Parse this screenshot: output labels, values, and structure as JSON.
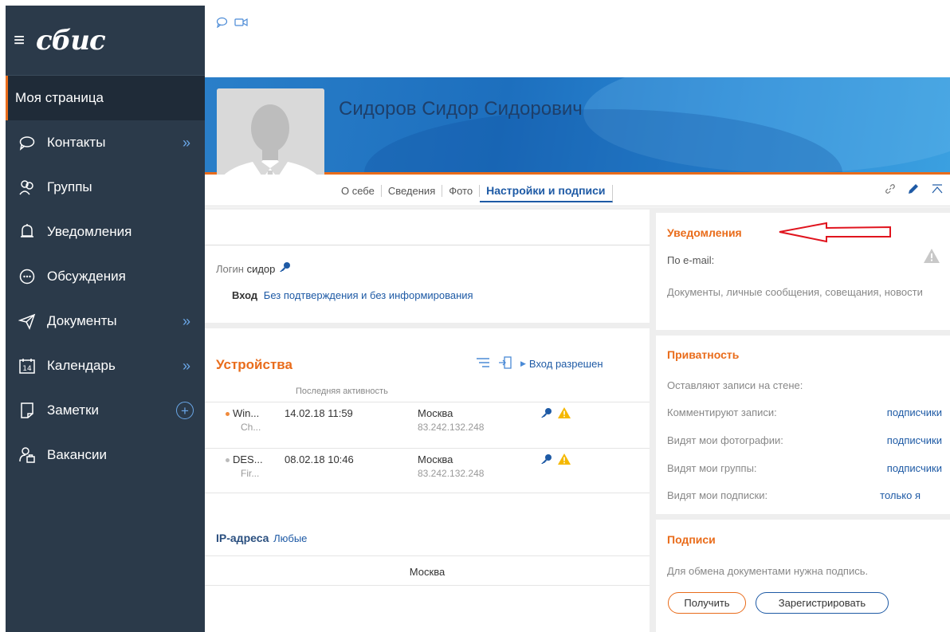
{
  "sidebar": {
    "logo": "сбис",
    "items": [
      {
        "label": "Моя страница"
      },
      {
        "label": "Контакты"
      },
      {
        "label": "Группы"
      },
      {
        "label": "Уведомления"
      },
      {
        "label": "Обсуждения"
      },
      {
        "label": "Документы"
      },
      {
        "label": "Календарь",
        "icon_text": "14"
      },
      {
        "label": "Заметки"
      },
      {
        "label": "Вакансии"
      }
    ]
  },
  "profile": {
    "name": "Сидоров Сидор Сидорович",
    "tabs": [
      "О себе",
      "Сведения",
      "Фото",
      "Настройки и подписи"
    ]
  },
  "login": {
    "label": "Логин",
    "value": "сидор",
    "entry_label": "Вход",
    "entry_value": "Без подтверждения и без информирования"
  },
  "devices": {
    "title": "Устройства",
    "subtitle": "Последняя активность",
    "allowed": "Вход разрешен",
    "rows": [
      {
        "os": "Win...",
        "browser": "Ch...",
        "datetime": "14.02.18  11:59",
        "city": "Москва",
        "ip": "83.242.132.248",
        "dot_color": "#f08a3c"
      },
      {
        "os": "DES...",
        "browser": "Fir...",
        "datetime": "08.02.18  10:46",
        "city": "Москва",
        "ip": "83.242.132.248",
        "dot_color": "#bbbbbb"
      }
    ],
    "ip_label": "IP-адреса",
    "ip_value": "Любые",
    "ip_city": "Москва"
  },
  "notifications": {
    "title": "Уведомления",
    "email_label": "По e-mail:",
    "description": "Документы, личные сообщения, совещания, новости"
  },
  "privacy": {
    "title": "Приватность",
    "wall_label": "Оставляют записи на стене:",
    "rows": [
      {
        "label": "Комментируют записи:",
        "value": "подписчики"
      },
      {
        "label": "Видят мои фотографии:",
        "value": "подписчики"
      },
      {
        "label": "Видят мои группы:",
        "value": "подписчики"
      },
      {
        "label": "Видят мои подписки:",
        "value": "только я"
      }
    ]
  },
  "signatures": {
    "title": "Подписи",
    "text": "Для обмена документами нужна подпись.",
    "get_button": "Получить",
    "register_button": "Зарегистрировать"
  },
  "colors": {
    "sidebar_bg": "#2b3a4a",
    "accent_orange": "#e96c1b",
    "link_blue": "#1e5aa5",
    "annotation_red": "#e0141e"
  }
}
